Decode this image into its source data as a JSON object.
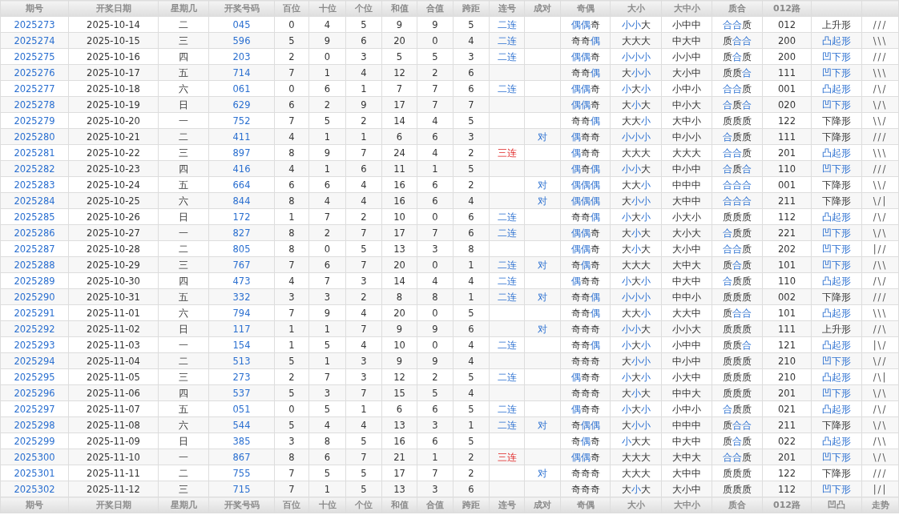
{
  "header": [
    "期号",
    "开奖日期",
    "星期几",
    "开奖号码",
    "百位",
    "十位",
    "个位",
    "和值",
    "合值",
    "跨距",
    "连号",
    "成对",
    "奇偶",
    "大小",
    "大中小",
    "质合",
    "012路"
  ],
  "rows": [
    {
      "issue": "2025273",
      "date": "2025-10-14",
      "weekday": "二",
      "number": "045",
      "hundreds": "0",
      "tens": "4",
      "units": "5",
      "sum": "9",
      "sum_tail": "9",
      "span": "5",
      "consecutive": {
        "text": "二连",
        "kind": "double"
      },
      "odd_even": {
        "text": "偶偶奇",
        "hl": [
          true,
          true,
          false
        ]
      },
      "big_small": {
        "text": "小小大",
        "hl": [
          true,
          true,
          false
        ]
      },
      "big_mid_small": "小中中",
      "prime_composite": {
        "text": "合合质",
        "hl": [
          true,
          true,
          false
        ]
      },
      "route_012": "012",
      "shape": {
        "text": "上升形",
        "hl": false
      },
      "trend": "///"
    },
    {
      "issue": "2025274",
      "date": "2025-10-15",
      "weekday": "三",
      "number": "596",
      "hundreds": "5",
      "tens": "9",
      "units": "6",
      "sum": "20",
      "sum_tail": "0",
      "span": "4",
      "consecutive": {
        "text": "二连",
        "kind": "double"
      },
      "odd_even": {
        "text": "奇奇偶",
        "hl": [
          false,
          false,
          true
        ]
      },
      "big_small": {
        "text": "大大大",
        "hl": [
          false,
          false,
          false
        ]
      },
      "big_mid_small": "中大中",
      "prime_composite": {
        "text": "质合合",
        "hl": [
          false,
          true,
          true
        ]
      },
      "route_012": "200",
      "shape": {
        "text": "凸起形",
        "hl": true
      },
      "trend": "\\\\\\"
    },
    {
      "issue": "2025275",
      "date": "2025-10-16",
      "weekday": "四",
      "number": "203",
      "hundreds": "2",
      "tens": "0",
      "units": "3",
      "sum": "5",
      "sum_tail": "5",
      "span": "3",
      "consecutive": {
        "text": "二连",
        "kind": "double"
      },
      "odd_even": {
        "text": "偶偶奇",
        "hl": [
          true,
          true,
          false
        ]
      },
      "big_small": {
        "text": "小小小",
        "hl": [
          true,
          true,
          true
        ]
      },
      "big_mid_small": "小小中",
      "prime_composite": {
        "text": "质合质",
        "hl": [
          false,
          true,
          false
        ]
      },
      "route_012": "200",
      "shape": {
        "text": "凹下形",
        "hl": true
      },
      "trend": "///"
    },
    {
      "issue": "2025276",
      "date": "2025-10-17",
      "weekday": "五",
      "number": "714",
      "hundreds": "7",
      "tens": "1",
      "units": "4",
      "sum": "12",
      "sum_tail": "2",
      "span": "6",
      "odd_even": {
        "text": "奇奇偶",
        "hl": [
          false,
          false,
          true
        ]
      },
      "big_small": {
        "text": "大小小",
        "hl": [
          false,
          true,
          true
        ]
      },
      "big_mid_small": "大小中",
      "prime_composite": {
        "text": "质质合",
        "hl": [
          false,
          false,
          true
        ]
      },
      "route_012": "111",
      "shape": {
        "text": "凹下形",
        "hl": true
      },
      "trend": "\\\\\\"
    },
    {
      "issue": "2025277",
      "date": "2025-10-18",
      "weekday": "六",
      "number": "061",
      "hundreds": "0",
      "tens": "6",
      "units": "1",
      "sum": "7",
      "sum_tail": "7",
      "span": "6",
      "consecutive": {
        "text": "二连",
        "kind": "double"
      },
      "odd_even": {
        "text": "偶偶奇",
        "hl": [
          true,
          true,
          false
        ]
      },
      "big_small": {
        "text": "小大小",
        "hl": [
          true,
          false,
          true
        ]
      },
      "big_mid_small": "小中小",
      "prime_composite": {
        "text": "合合质",
        "hl": [
          true,
          true,
          false
        ]
      },
      "route_012": "001",
      "shape": {
        "text": "凸起形",
        "hl": true
      },
      "trend": "/\\/"
    },
    {
      "issue": "2025278",
      "date": "2025-10-19",
      "weekday": "日",
      "number": "629",
      "hundreds": "6",
      "tens": "2",
      "units": "9",
      "sum": "17",
      "sum_tail": "7",
      "span": "7",
      "odd_even": {
        "text": "偶偶奇",
        "hl": [
          true,
          true,
          false
        ]
      },
      "big_small": {
        "text": "大小大",
        "hl": [
          false,
          true,
          false
        ]
      },
      "big_mid_small": "中小大",
      "prime_composite": {
        "text": "合质合",
        "hl": [
          true,
          false,
          true
        ]
      },
      "route_012": "020",
      "shape": {
        "text": "凹下形",
        "hl": true
      },
      "trend": "\\/\\"
    },
    {
      "issue": "2025279",
      "date": "2025-10-20",
      "weekday": "一",
      "number": "752",
      "hundreds": "7",
      "tens": "5",
      "units": "2",
      "sum": "14",
      "sum_tail": "4",
      "span": "5",
      "odd_even": {
        "text": "奇奇偶",
        "hl": [
          false,
          false,
          true
        ]
      },
      "big_small": {
        "text": "大大小",
        "hl": [
          false,
          false,
          true
        ]
      },
      "big_mid_small": "大中小",
      "prime_composite": {
        "text": "质质质",
        "hl": [
          false,
          false,
          false
        ]
      },
      "route_012": "122",
      "shape": {
        "text": "下降形",
        "hl": false
      },
      "trend": "\\\\/"
    },
    {
      "issue": "2025280",
      "date": "2025-10-21",
      "weekday": "二",
      "number": "411",
      "hundreds": "4",
      "tens": "1",
      "units": "1",
      "sum": "6",
      "sum_tail": "6",
      "span": "3",
      "pair": "对",
      "odd_even": {
        "text": "偶奇奇",
        "hl": [
          true,
          false,
          false
        ]
      },
      "big_small": {
        "text": "小小小",
        "hl": [
          true,
          true,
          true
        ]
      },
      "big_mid_small": "中小小",
      "prime_composite": {
        "text": "合质质",
        "hl": [
          true,
          false,
          false
        ]
      },
      "route_012": "111",
      "shape": {
        "text": "下降形",
        "hl": false
      },
      "trend": "///"
    },
    {
      "issue": "2025281",
      "date": "2025-10-22",
      "weekday": "三",
      "number": "897",
      "hundreds": "8",
      "tens": "9",
      "units": "7",
      "sum": "24",
      "sum_tail": "4",
      "span": "2",
      "consecutive": {
        "text": "三连",
        "kind": "triple"
      },
      "odd_even": {
        "text": "偶奇奇",
        "hl": [
          true,
          false,
          false
        ]
      },
      "big_small": {
        "text": "大大大",
        "hl": [
          false,
          false,
          false
        ]
      },
      "big_mid_small": "大大大",
      "prime_composite": {
        "text": "合合质",
        "hl": [
          true,
          true,
          false
        ]
      },
      "route_012": "201",
      "shape": {
        "text": "凸起形",
        "hl": true
      },
      "trend": "\\\\\\"
    },
    {
      "issue": "2025282",
      "date": "2025-10-23",
      "weekday": "四",
      "number": "416",
      "hundreds": "4",
      "tens": "1",
      "units": "6",
      "sum": "11",
      "sum_tail": "1",
      "span": "5",
      "odd_even": {
        "text": "偶奇偶",
        "hl": [
          true,
          false,
          true
        ]
      },
      "big_small": {
        "text": "小小大",
        "hl": [
          true,
          true,
          false
        ]
      },
      "big_mid_small": "中小中",
      "prime_composite": {
        "text": "合质合",
        "hl": [
          true,
          false,
          true
        ]
      },
      "route_012": "110",
      "shape": {
        "text": "凹下形",
        "hl": true
      },
      "trend": "///"
    },
    {
      "issue": "2025283",
      "date": "2025-10-24",
      "weekday": "五",
      "number": "664",
      "hundreds": "6",
      "tens": "6",
      "units": "4",
      "sum": "16",
      "sum_tail": "6",
      "span": "2",
      "pair": "对",
      "odd_even": {
        "text": "偶偶偶",
        "hl": [
          true,
          true,
          true
        ]
      },
      "big_small": {
        "text": "大大小",
        "hl": [
          false,
          false,
          true
        ]
      },
      "big_mid_small": "中中中",
      "prime_composite": {
        "text": "合合合",
        "hl": [
          true,
          true,
          true
        ]
      },
      "route_012": "001",
      "shape": {
        "text": "下降形",
        "hl": false
      },
      "trend": "\\\\/"
    },
    {
      "issue": "2025284",
      "date": "2025-10-25",
      "weekday": "六",
      "number": "844",
      "hundreds": "8",
      "tens": "4",
      "units": "4",
      "sum": "16",
      "sum_tail": "6",
      "span": "4",
      "pair": "对",
      "odd_even": {
        "text": "偶偶偶",
        "hl": [
          true,
          true,
          true
        ]
      },
      "big_small": {
        "text": "大小小",
        "hl": [
          false,
          true,
          true
        ]
      },
      "big_mid_small": "大中中",
      "prime_composite": {
        "text": "合合合",
        "hl": [
          true,
          true,
          true
        ]
      },
      "route_012": "211",
      "shape": {
        "text": "下降形",
        "hl": false
      },
      "trend": "\\/|"
    },
    {
      "issue": "2025285",
      "date": "2025-10-26",
      "weekday": "日",
      "number": "172",
      "hundreds": "1",
      "tens": "7",
      "units": "2",
      "sum": "10",
      "sum_tail": "0",
      "span": "6",
      "consecutive": {
        "text": "二连",
        "kind": "double"
      },
      "odd_even": {
        "text": "奇奇偶",
        "hl": [
          false,
          false,
          true
        ]
      },
      "big_small": {
        "text": "小大小",
        "hl": [
          true,
          false,
          true
        ]
      },
      "big_mid_small": "小大小",
      "prime_composite": {
        "text": "质质质",
        "hl": [
          false,
          false,
          false
        ]
      },
      "route_012": "112",
      "shape": {
        "text": "凸起形",
        "hl": true
      },
      "trend": "/\\/"
    },
    {
      "issue": "2025286",
      "date": "2025-10-27",
      "weekday": "一",
      "number": "827",
      "hundreds": "8",
      "tens": "2",
      "units": "7",
      "sum": "17",
      "sum_tail": "7",
      "span": "6",
      "consecutive": {
        "text": "二连",
        "kind": "double"
      },
      "odd_even": {
        "text": "偶偶奇",
        "hl": [
          true,
          true,
          false
        ]
      },
      "big_small": {
        "text": "大小大",
        "hl": [
          false,
          true,
          false
        ]
      },
      "big_mid_small": "大小大",
      "prime_composite": {
        "text": "合质质",
        "hl": [
          true,
          false,
          false
        ]
      },
      "route_012": "221",
      "shape": {
        "text": "凹下形",
        "hl": true
      },
      "trend": "\\/\\"
    },
    {
      "issue": "2025287",
      "date": "2025-10-28",
      "weekday": "二",
      "number": "805",
      "hundreds": "8",
      "tens": "0",
      "units": "5",
      "sum": "13",
      "sum_tail": "3",
      "span": "8",
      "odd_even": {
        "text": "偶偶奇",
        "hl": [
          true,
          true,
          false
        ]
      },
      "big_small": {
        "text": "大小大",
        "hl": [
          false,
          true,
          false
        ]
      },
      "big_mid_small": "大小中",
      "prime_composite": {
        "text": "合合质",
        "hl": [
          true,
          true,
          false
        ]
      },
      "route_012": "202",
      "shape": {
        "text": "凹下形",
        "hl": true
      },
      "trend": "|//"
    },
    {
      "issue": "2025288",
      "date": "2025-10-29",
      "weekday": "三",
      "number": "767",
      "hundreds": "7",
      "tens": "6",
      "units": "7",
      "sum": "20",
      "sum_tail": "0",
      "span": "1",
      "consecutive": {
        "text": "二连",
        "kind": "double"
      },
      "pair": "对",
      "odd_even": {
        "text": "奇偶奇",
        "hl": [
          false,
          true,
          false
        ]
      },
      "big_small": {
        "text": "大大大",
        "hl": [
          false,
          false,
          false
        ]
      },
      "big_mid_small": "大中大",
      "prime_composite": {
        "text": "质合质",
        "hl": [
          false,
          true,
          false
        ]
      },
      "route_012": "101",
      "shape": {
        "text": "凹下形",
        "hl": true
      },
      "trend": "/\\\\"
    },
    {
      "issue": "2025289",
      "date": "2025-10-30",
      "weekday": "四",
      "number": "473",
      "hundreds": "4",
      "tens": "7",
      "units": "3",
      "sum": "14",
      "sum_tail": "4",
      "span": "4",
      "consecutive": {
        "text": "二连",
        "kind": "double"
      },
      "odd_even": {
        "text": "偶奇奇",
        "hl": [
          true,
          false,
          false
        ]
      },
      "big_small": {
        "text": "小大小",
        "hl": [
          true,
          false,
          true
        ]
      },
      "big_mid_small": "中大中",
      "prime_composite": {
        "text": "合质质",
        "hl": [
          true,
          false,
          false
        ]
      },
      "route_012": "110",
      "shape": {
        "text": "凸起形",
        "hl": true
      },
      "trend": "/\\/"
    },
    {
      "issue": "2025290",
      "date": "2025-10-31",
      "weekday": "五",
      "number": "332",
      "hundreds": "3",
      "tens": "3",
      "units": "2",
      "sum": "8",
      "sum_tail": "8",
      "span": "1",
      "consecutive": {
        "text": "二连",
        "kind": "double"
      },
      "pair": "对",
      "odd_even": {
        "text": "奇奇偶",
        "hl": [
          false,
          false,
          true
        ]
      },
      "big_small": {
        "text": "小小小",
        "hl": [
          true,
          true,
          true
        ]
      },
      "big_mid_small": "中中小",
      "prime_composite": {
        "text": "质质质",
        "hl": [
          false,
          false,
          false
        ]
      },
      "route_012": "002",
      "shape": {
        "text": "下降形",
        "hl": false
      },
      "trend": "///"
    },
    {
      "issue": "2025291",
      "date": "2025-11-01",
      "weekday": "六",
      "number": "794",
      "hundreds": "7",
      "tens": "9",
      "units": "4",
      "sum": "20",
      "sum_tail": "0",
      "span": "5",
      "odd_even": {
        "text": "奇奇偶",
        "hl": [
          false,
          false,
          true
        ]
      },
      "big_small": {
        "text": "大大小",
        "hl": [
          false,
          false,
          true
        ]
      },
      "big_mid_small": "大大中",
      "prime_composite": {
        "text": "质合合",
        "hl": [
          false,
          true,
          true
        ]
      },
      "route_012": "101",
      "shape": {
        "text": "凸起形",
        "hl": true
      },
      "trend": "\\\\\\"
    },
    {
      "issue": "2025292",
      "date": "2025-11-02",
      "weekday": "日",
      "number": "117",
      "hundreds": "1",
      "tens": "1",
      "units": "7",
      "sum": "9",
      "sum_tail": "9",
      "span": "6",
      "pair": "对",
      "odd_even": {
        "text": "奇奇奇",
        "hl": [
          false,
          false,
          false
        ]
      },
      "big_small": {
        "text": "小小大",
        "hl": [
          true,
          true,
          false
        ]
      },
      "big_mid_small": "小小大",
      "prime_composite": {
        "text": "质质质",
        "hl": [
          false,
          false,
          false
        ]
      },
      "route_012": "111",
      "shape": {
        "text": "上升形",
        "hl": false
      },
      "trend": "//\\"
    },
    {
      "issue": "2025293",
      "date": "2025-11-03",
      "weekday": "一",
      "number": "154",
      "hundreds": "1",
      "tens": "5",
      "units": "4",
      "sum": "10",
      "sum_tail": "0",
      "span": "4",
      "consecutive": {
        "text": "二连",
        "kind": "double"
      },
      "odd_even": {
        "text": "奇奇偶",
        "hl": [
          false,
          false,
          true
        ]
      },
      "big_small": {
        "text": "小大小",
        "hl": [
          true,
          false,
          true
        ]
      },
      "big_mid_small": "小中中",
      "prime_composite": {
        "text": "质质合",
        "hl": [
          false,
          false,
          true
        ]
      },
      "route_012": "121",
      "shape": {
        "text": "凸起形",
        "hl": true
      },
      "trend": "|\\/"
    },
    {
      "issue": "2025294",
      "date": "2025-11-04",
      "weekday": "二",
      "number": "513",
      "hundreds": "5",
      "tens": "1",
      "units": "3",
      "sum": "9",
      "sum_tail": "9",
      "span": "4",
      "odd_even": {
        "text": "奇奇奇",
        "hl": [
          false,
          false,
          false
        ]
      },
      "big_small": {
        "text": "大小小",
        "hl": [
          false,
          true,
          true
        ]
      },
      "big_mid_small": "中小中",
      "prime_composite": {
        "text": "质质质",
        "hl": [
          false,
          false,
          false
        ]
      },
      "route_012": "210",
      "shape": {
        "text": "凹下形",
        "hl": true
      },
      "trend": "\\//"
    },
    {
      "issue": "2025295",
      "date": "2025-11-05",
      "weekday": "三",
      "number": "273",
      "hundreds": "2",
      "tens": "7",
      "units": "3",
      "sum": "12",
      "sum_tail": "2",
      "span": "5",
      "consecutive": {
        "text": "二连",
        "kind": "double"
      },
      "odd_even": {
        "text": "偶奇奇",
        "hl": [
          true,
          false,
          false
        ]
      },
      "big_small": {
        "text": "小大小",
        "hl": [
          true,
          false,
          true
        ]
      },
      "big_mid_small": "小大中",
      "prime_composite": {
        "text": "质质质",
        "hl": [
          false,
          false,
          false
        ]
      },
      "route_012": "210",
      "shape": {
        "text": "凸起形",
        "hl": true
      },
      "trend": "/\\|"
    },
    {
      "issue": "2025296",
      "date": "2025-11-06",
      "weekday": "四",
      "number": "537",
      "hundreds": "5",
      "tens": "3",
      "units": "7",
      "sum": "15",
      "sum_tail": "5",
      "span": "4",
      "odd_even": {
        "text": "奇奇奇",
        "hl": [
          false,
          false,
          false
        ]
      },
      "big_small": {
        "text": "大小大",
        "hl": [
          false,
          true,
          false
        ]
      },
      "big_mid_small": "中中大",
      "prime_composite": {
        "text": "质质质",
        "hl": [
          false,
          false,
          false
        ]
      },
      "route_012": "201",
      "shape": {
        "text": "凹下形",
        "hl": true
      },
      "trend": "\\/\\"
    },
    {
      "issue": "2025297",
      "date": "2025-11-07",
      "weekday": "五",
      "number": "051",
      "hundreds": "0",
      "tens": "5",
      "units": "1",
      "sum": "6",
      "sum_tail": "6",
      "span": "5",
      "consecutive": {
        "text": "二连",
        "kind": "double"
      },
      "odd_even": {
        "text": "偶奇奇",
        "hl": [
          true,
          false,
          false
        ]
      },
      "big_small": {
        "text": "小大小",
        "hl": [
          true,
          false,
          true
        ]
      },
      "big_mid_small": "小中小",
      "prime_composite": {
        "text": "合质质",
        "hl": [
          true,
          false,
          false
        ]
      },
      "route_012": "021",
      "shape": {
        "text": "凸起形",
        "hl": true
      },
      "trend": "/\\/"
    },
    {
      "issue": "2025298",
      "date": "2025-11-08",
      "weekday": "六",
      "number": "544",
      "hundreds": "5",
      "tens": "4",
      "units": "4",
      "sum": "13",
      "sum_tail": "3",
      "span": "1",
      "consecutive": {
        "text": "二连",
        "kind": "double"
      },
      "pair": "对",
      "odd_even": {
        "text": "奇偶偶",
        "hl": [
          false,
          true,
          true
        ]
      },
      "big_small": {
        "text": "大小小",
        "hl": [
          false,
          true,
          true
        ]
      },
      "big_mid_small": "中中中",
      "prime_composite": {
        "text": "质合合",
        "hl": [
          false,
          true,
          true
        ]
      },
      "route_012": "211",
      "shape": {
        "text": "下降形",
        "hl": false
      },
      "trend": "\\/\\"
    },
    {
      "issue": "2025299",
      "date": "2025-11-09",
      "weekday": "日",
      "number": "385",
      "hundreds": "3",
      "tens": "8",
      "units": "5",
      "sum": "16",
      "sum_tail": "6",
      "span": "5",
      "odd_even": {
        "text": "奇偶奇",
        "hl": [
          false,
          true,
          false
        ]
      },
      "big_small": {
        "text": "小大大",
        "hl": [
          true,
          false,
          false
        ]
      },
      "big_mid_small": "中大中",
      "prime_composite": {
        "text": "质合质",
        "hl": [
          false,
          true,
          false
        ]
      },
      "route_012": "022",
      "shape": {
        "text": "凸起形",
        "hl": true
      },
      "trend": "/\\\\"
    },
    {
      "issue": "2025300",
      "date": "2025-11-10",
      "weekday": "一",
      "number": "867",
      "hundreds": "8",
      "tens": "6",
      "units": "7",
      "sum": "21",
      "sum_tail": "1",
      "span": "2",
      "consecutive": {
        "text": "三连",
        "kind": "triple"
      },
      "odd_even": {
        "text": "偶偶奇",
        "hl": [
          true,
          true,
          false
        ]
      },
      "big_small": {
        "text": "大大大",
        "hl": [
          false,
          false,
          false
        ]
      },
      "big_mid_small": "大中大",
      "prime_composite": {
        "text": "合合质",
        "hl": [
          true,
          true,
          false
        ]
      },
      "route_012": "201",
      "shape": {
        "text": "凹下形",
        "hl": true
      },
      "trend": "\\/\\"
    },
    {
      "issue": "2025301",
      "date": "2025-11-11",
      "weekday": "二",
      "number": "755",
      "hundreds": "7",
      "tens": "5",
      "units": "5",
      "sum": "17",
      "sum_tail": "7",
      "span": "2",
      "pair": "对",
      "odd_even": {
        "text": "奇奇奇",
        "hl": [
          false,
          false,
          false
        ]
      },
      "big_small": {
        "text": "大大大",
        "hl": [
          false,
          false,
          false
        ]
      },
      "big_mid_small": "大中中",
      "prime_composite": {
        "text": "质质质",
        "hl": [
          false,
          false,
          false
        ]
      },
      "route_012": "122",
      "shape": {
        "text": "下降形",
        "hl": false
      },
      "trend": "///"
    },
    {
      "issue": "2025302",
      "date": "2025-11-12",
      "weekday": "三",
      "number": "715",
      "hundreds": "7",
      "tens": "1",
      "units": "5",
      "sum": "13",
      "sum_tail": "3",
      "span": "6",
      "odd_even": {
        "text": "奇奇奇",
        "hl": [
          false,
          false,
          false
        ]
      },
      "big_small": {
        "text": "大小大",
        "hl": [
          false,
          true,
          false
        ]
      },
      "big_mid_small": "大小中",
      "prime_composite": {
        "text": "质质质",
        "hl": [
          false,
          false,
          false
        ]
      },
      "route_012": "112",
      "shape": {
        "text": "凹下形",
        "hl": true
      },
      "trend": "|/|"
    }
  ],
  "footer": [
    "期号",
    "开奖日期",
    "星期几",
    "开奖号码",
    "百位",
    "十位",
    "个位",
    "和值",
    "合值",
    "跨距",
    "连号",
    "成对",
    "奇偶",
    "大小",
    "大中小",
    "质合",
    "012路",
    "凹凸",
    "走势"
  ]
}
